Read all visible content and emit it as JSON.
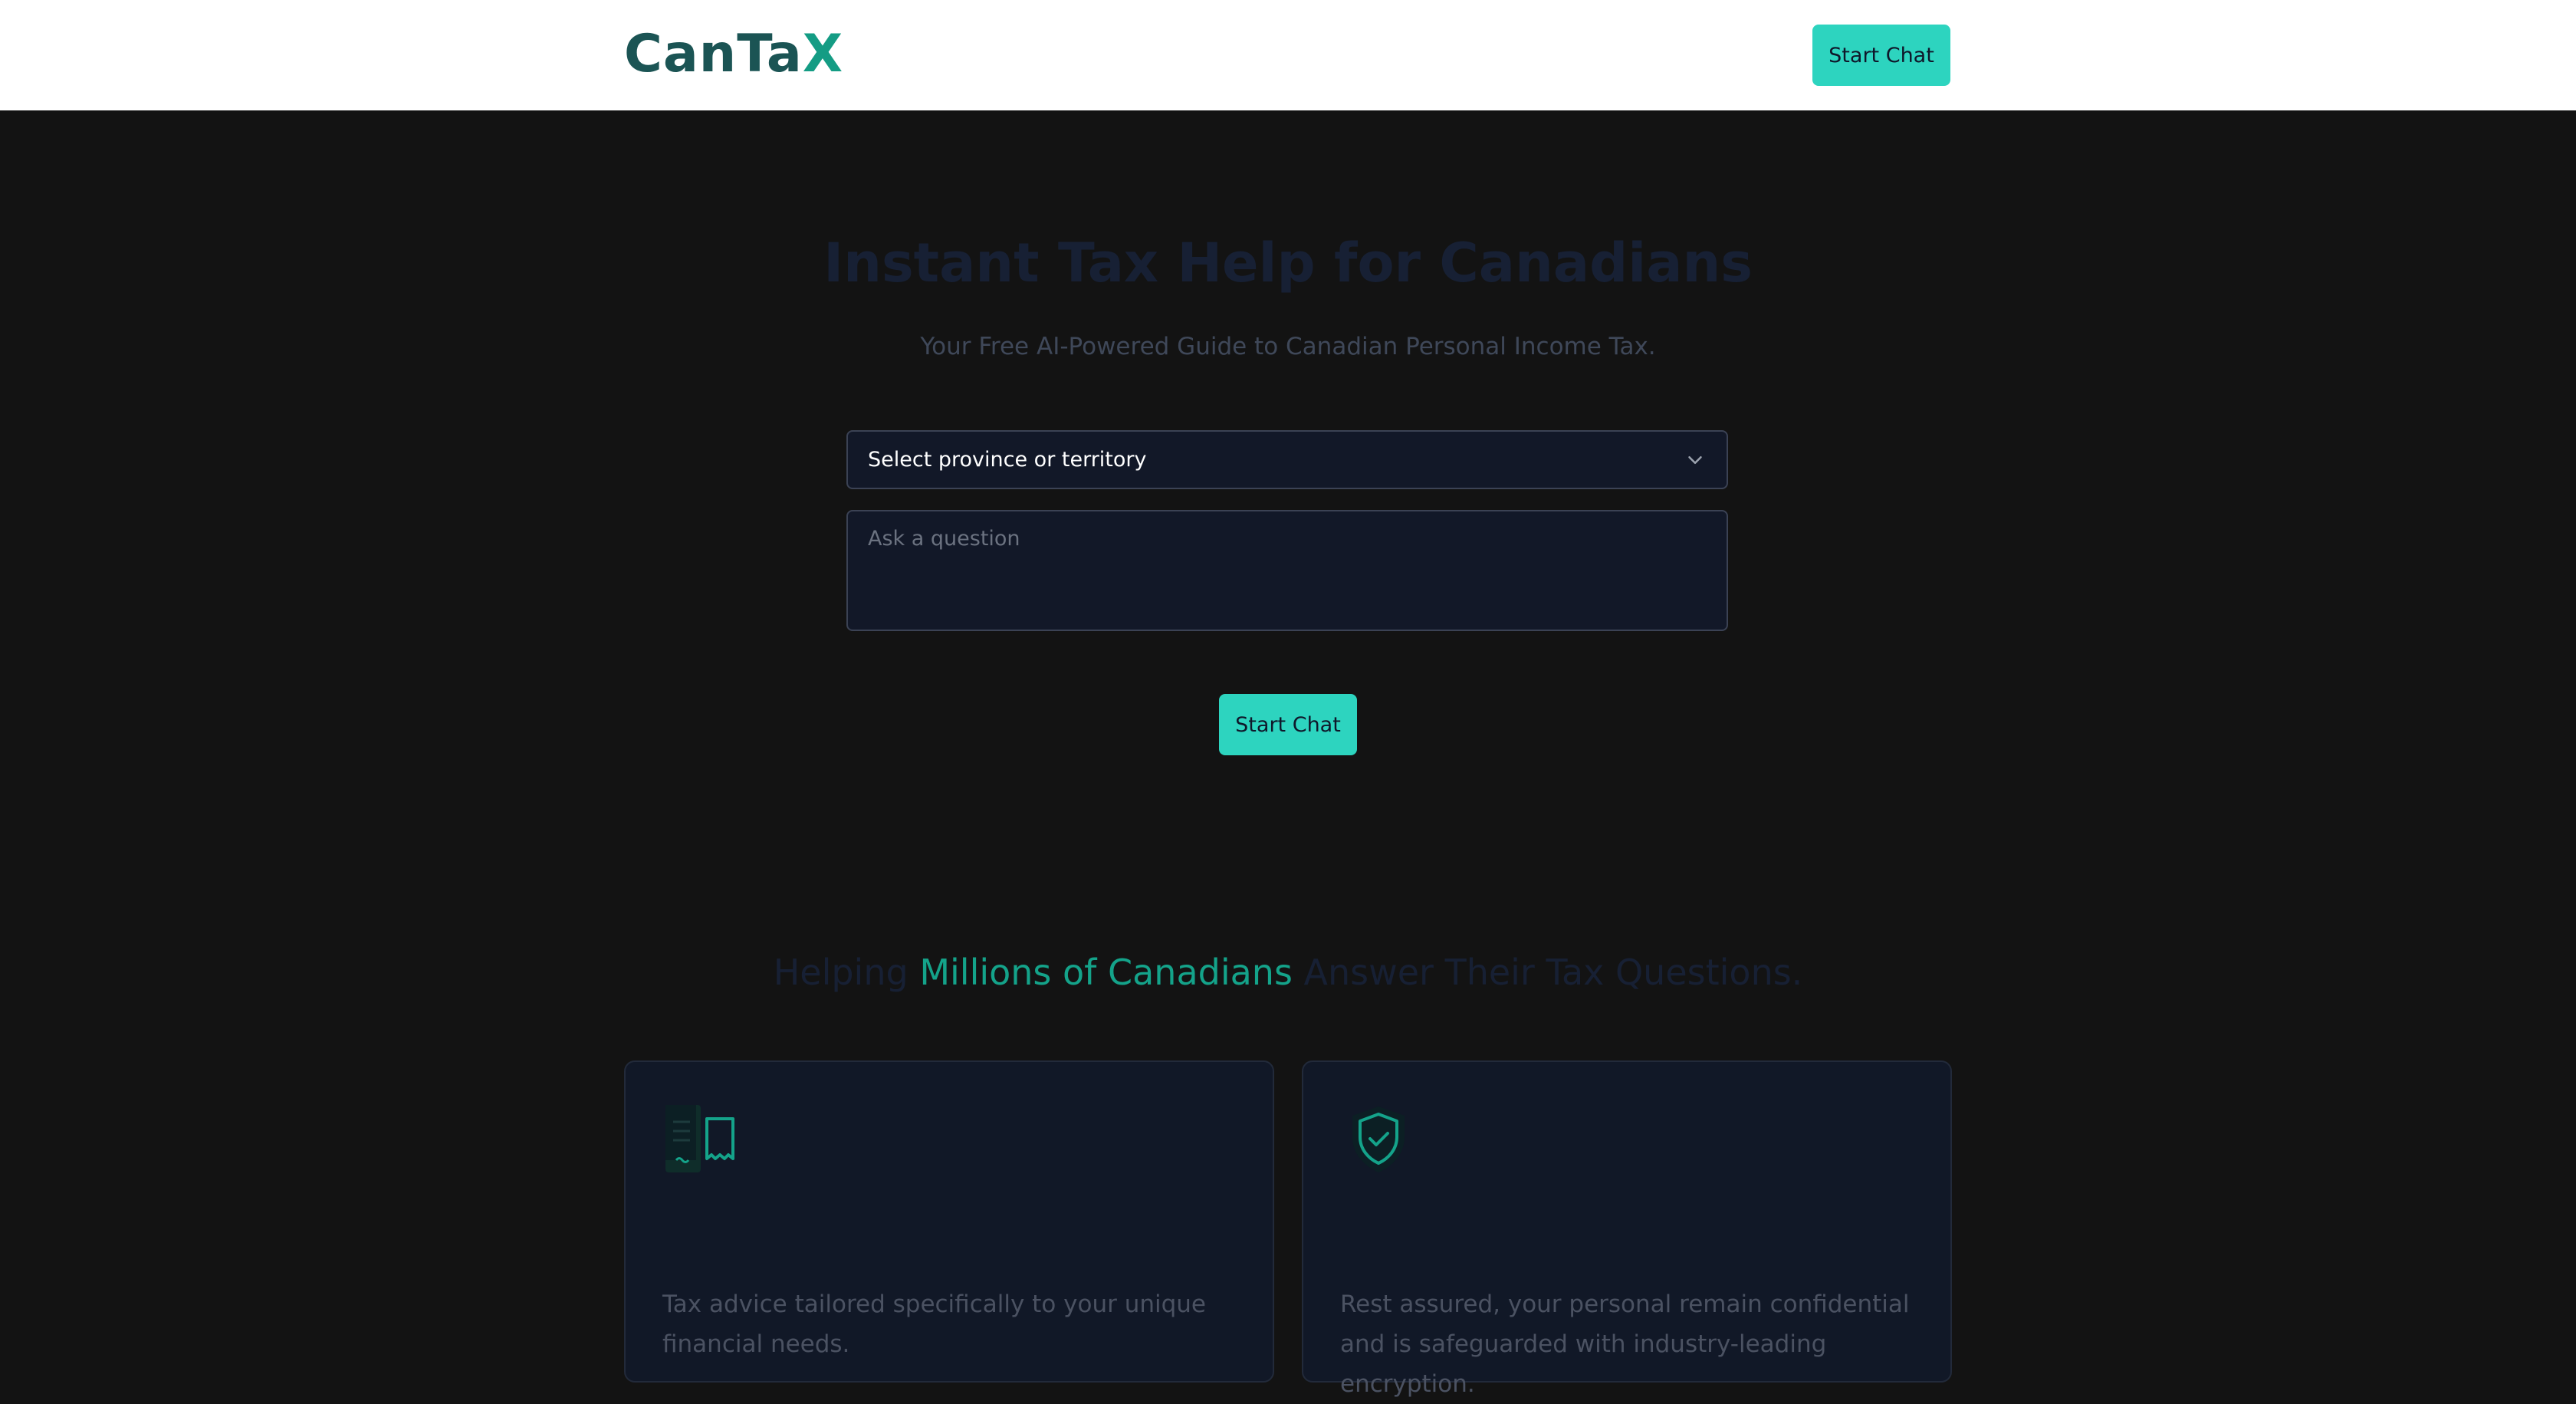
{
  "header": {
    "logo_text": "CanTa",
    "logo_mark": "X",
    "start_chat_label": "Start Chat"
  },
  "hero": {
    "title": "Instant Tax Help for Canadians",
    "subtitle": "Your Free AI-Powered Guide to Canadian Personal Income Tax.",
    "province_select": {
      "selected": "Select province or territory",
      "icon": "chevron-down-icon"
    },
    "question": {
      "placeholder": "Ask a question",
      "value": ""
    },
    "start_chat_label": "Start Chat"
  },
  "section": {
    "title_prefix": "Helping ",
    "title_highlight": "Millions of Canadians",
    "title_suffix": " Answer Their Tax Questions."
  },
  "cards": [
    {
      "icon": "document-receipt-icon",
      "description": "Tax advice tailored specifically to your unique financial needs."
    },
    {
      "icon": "shield-check-icon",
      "description": "Rest assured, your personal remain confidential and is safeguarded with industry-leading encryption."
    }
  ],
  "colors": {
    "accent": "#2dd4bf",
    "brand": "#1b5454",
    "highlight": "#14a38a",
    "background": "#131313",
    "card_bg": "#111827"
  }
}
